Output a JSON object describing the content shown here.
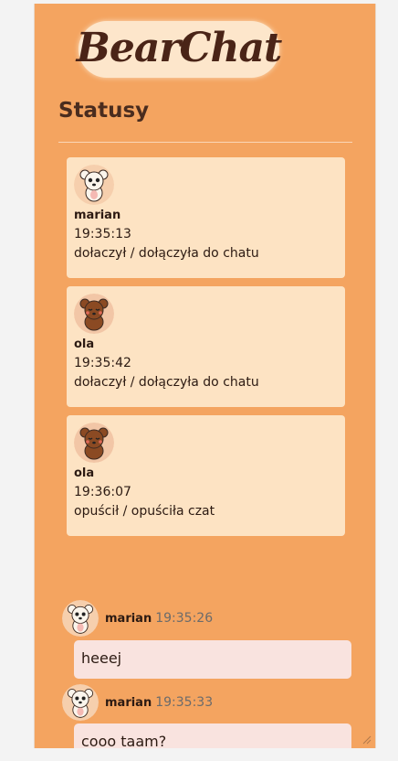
{
  "app": {
    "logo_text": "BearChat"
  },
  "statuses": {
    "title": "Statusy",
    "items": [
      {
        "user": "marian",
        "time": "19:35:13",
        "message": "dołaczył / dołączyła do chatu",
        "avatar": "white-bear-icon"
      },
      {
        "user": "ola",
        "time": "19:35:42",
        "message": "dołaczył / dołączyła do chatu",
        "avatar": "brown-bear-icon"
      },
      {
        "user": "ola",
        "time": "19:36:07",
        "message": "opuścił / opuściła czat",
        "avatar": "brown-bear-icon"
      }
    ]
  },
  "messages": [
    {
      "user": "marian",
      "time": "19:35:26",
      "text": "heeej",
      "avatar": "white-bear-icon"
    },
    {
      "user": "marian",
      "time": "19:35:33",
      "text": "cooo taam?",
      "avatar": "white-bear-icon"
    }
  ],
  "colors": {
    "panel_bg": "#f4a460",
    "status_card_bg": "#fde3c3",
    "message_bubble_bg": "#f9e3df",
    "logo_text": "#4a2417",
    "heading_text": "#4a2c1e",
    "timestamp_text": "#6b6b6b"
  }
}
